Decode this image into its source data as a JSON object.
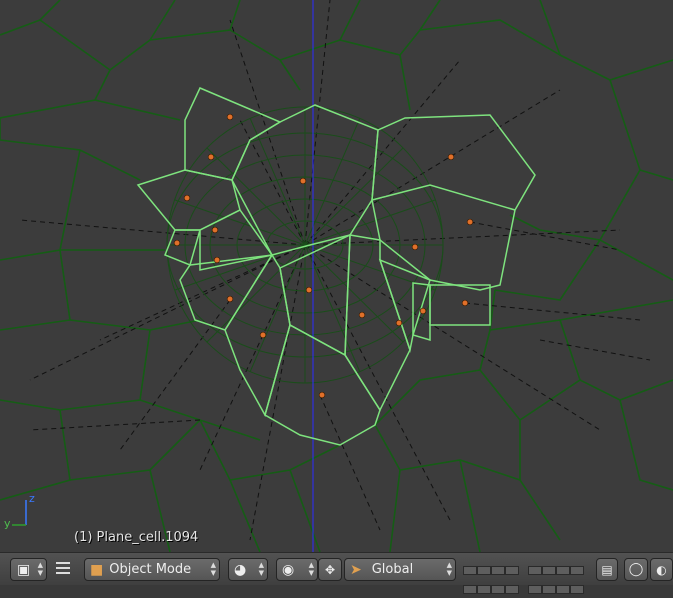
{
  "viewport": {
    "object_info": "(1) Plane_cell.1094",
    "axis_z_label": "z",
    "axis_y_label": "y"
  },
  "header": {
    "mode_label": "Object Mode",
    "orientation_label": "Global"
  },
  "colors": {
    "background": "#3c3c3c",
    "cell_edge": "#1e6b1e",
    "selected_edge": "#7ee37e",
    "point": "#e0702a",
    "z_axis": "#2c2cff",
    "header": "#4a4a4a"
  }
}
